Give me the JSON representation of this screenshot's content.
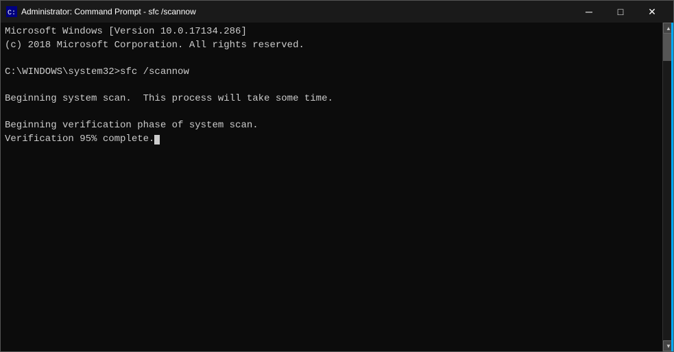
{
  "window": {
    "title": "Administrator: Command Prompt - sfc /scannow"
  },
  "titlebar": {
    "icon_label": "cmd-icon",
    "minimize_label": "─",
    "maximize_label": "□",
    "close_label": "✕"
  },
  "console": {
    "lines": [
      "Microsoft Windows [Version 10.0.17134.286]",
      "(c) 2018 Microsoft Corporation. All rights reserved.",
      "",
      "C:\\WINDOWS\\system32>sfc /scannow",
      "",
      "Beginning system scan.  This process will take some time.",
      "",
      "Beginning verification phase of system scan.",
      "Verification 95% complete."
    ]
  }
}
